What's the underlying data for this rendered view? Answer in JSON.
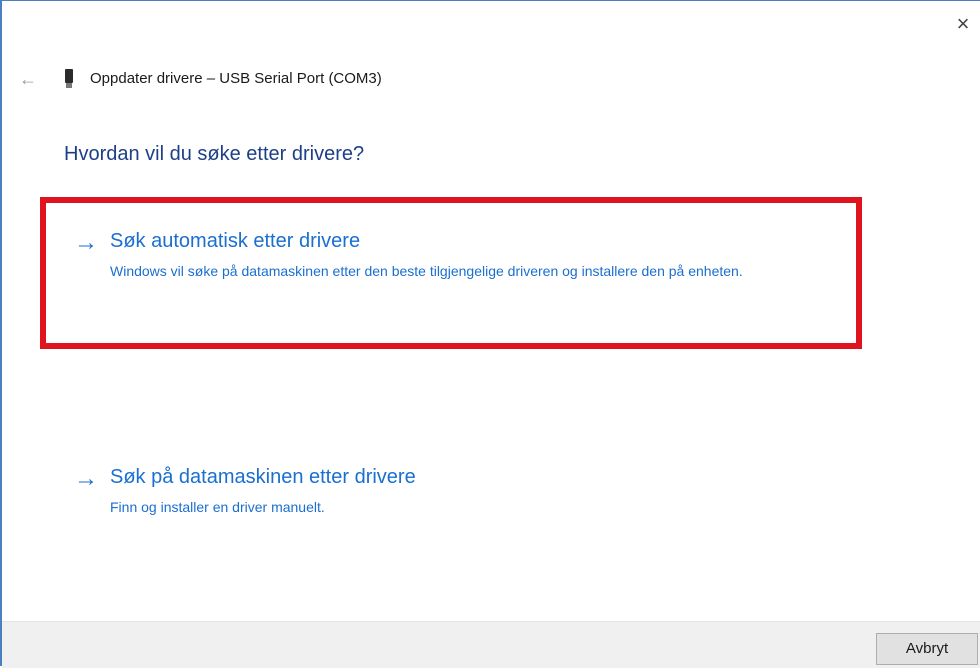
{
  "window": {
    "title": "Oppdater drivere – USB Serial Port (COM3)",
    "close_icon": "×",
    "back_icon": "←"
  },
  "question": "Hvordan vil du søke etter drivere?",
  "options": [
    {
      "arrow": "→",
      "title": "Søk automatisk etter drivere",
      "description": "Windows vil søke på datamaskinen etter den beste tilgjengelige driveren og installere den på enheten.",
      "highlighted": true
    },
    {
      "arrow": "→",
      "title": "Søk på datamaskinen etter drivere",
      "description": "Finn og installer en driver manuelt.",
      "highlighted": false
    }
  ],
  "footer": {
    "cancel_label": "Avbryt"
  },
  "colors": {
    "accent": "#1a6fd0",
    "heading": "#1e3f87",
    "highlight_border": "#e0141e",
    "footer_bg": "#f0f0f0"
  }
}
